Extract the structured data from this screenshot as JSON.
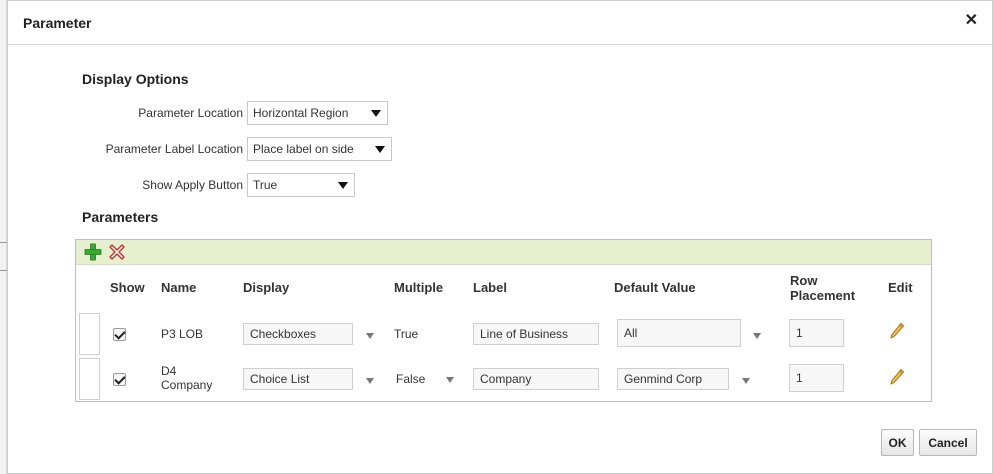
{
  "dialog": {
    "title": "Parameter",
    "close_symbol": "✕"
  },
  "display_options": {
    "heading": "Display Options",
    "parameter_location": {
      "label": "Parameter Location",
      "value": "Horizontal Region"
    },
    "parameter_label_location": {
      "label": "Parameter Label Location",
      "value": "Place label on side"
    },
    "show_apply_button": {
      "label": "Show Apply Button",
      "value": "True"
    }
  },
  "parameters": {
    "heading": "Parameters",
    "toolbar": {
      "add_icon": "plus-icon",
      "delete_icon": "delete-x-icon"
    },
    "columns": {
      "show": "Show",
      "name": "Name",
      "display": "Display",
      "multiple": "Multiple",
      "label": "Label",
      "default_value": "Default Value",
      "row_placement_1": "Row",
      "row_placement_2": "Placement",
      "edit": "Edit"
    },
    "rows": [
      {
        "show": true,
        "name_1": "P3 LOB",
        "name_2": "",
        "display": "Checkboxes",
        "multiple": "True",
        "label": "Line of Business",
        "default_value": "All",
        "row_placement": "1"
      },
      {
        "show": true,
        "name_1": "D4",
        "name_2": "Company",
        "display": "Choice List",
        "multiple": "False",
        "label": "Company",
        "default_value": "Genmind Corp",
        "row_placement": "1"
      }
    ]
  },
  "footer": {
    "ok_label": "OK",
    "cancel_label": "Cancel"
  },
  "colors": {
    "toolbar_bg": "#e6f0cf",
    "add_green": "#3aa832",
    "delete_red": "#c0312b",
    "edit_pencil": "#b07a12"
  }
}
